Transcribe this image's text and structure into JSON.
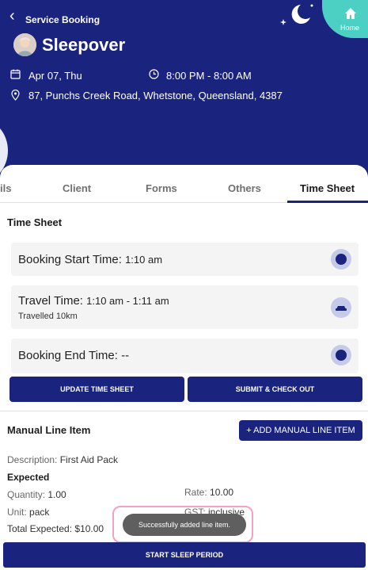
{
  "header": {
    "back_label": "Service Booking",
    "title": "Sleepover",
    "date": "Apr 07, Thu",
    "time": "8:00 PM - 8:00 AM",
    "address": "87, Punchs Creek Road, Whetstone, Queensland, 4387",
    "home_label": "Home"
  },
  "tabs": [
    "ils",
    "Client",
    "Forms",
    "Others",
    "Time Sheet"
  ],
  "timesheet": {
    "section_title": "Time Sheet",
    "booking_start_label": "Booking Start Time:",
    "booking_start_value": "1:10 am",
    "travel_label": "Travel Time:",
    "travel_value": "1:10 am - 1:11 am",
    "travel_sub": "Travelled 10km",
    "booking_end_label": "Booking End Time:",
    "booking_end_value": "--",
    "update_button": "UPDATE TIME SHEET",
    "submit_button": "SUBMIT & CHECK OUT"
  },
  "manual": {
    "title": "Manual Line Item",
    "add_button": "+ ADD MANUAL LINE ITEM",
    "description_label": "Description:",
    "description_value": "First Aid Pack",
    "expected_label": "Expected",
    "quantity_label": "Quantity:",
    "quantity_value": "1.00",
    "rate_label": "Rate:",
    "rate_value": "10.00",
    "unit_label": "Unit:",
    "unit_value": "pack",
    "gst_label": "GST:",
    "gst_value": "inclusive",
    "total_label": "Total Expected:",
    "total_value": "$10.00"
  },
  "toast": "Successfully added line item.",
  "sleep_button": "START SLEEP PERIOD",
  "colors": {
    "primary": "#1a237e",
    "accent": "#4dd0c4",
    "row_bg": "#f4f4f4"
  }
}
